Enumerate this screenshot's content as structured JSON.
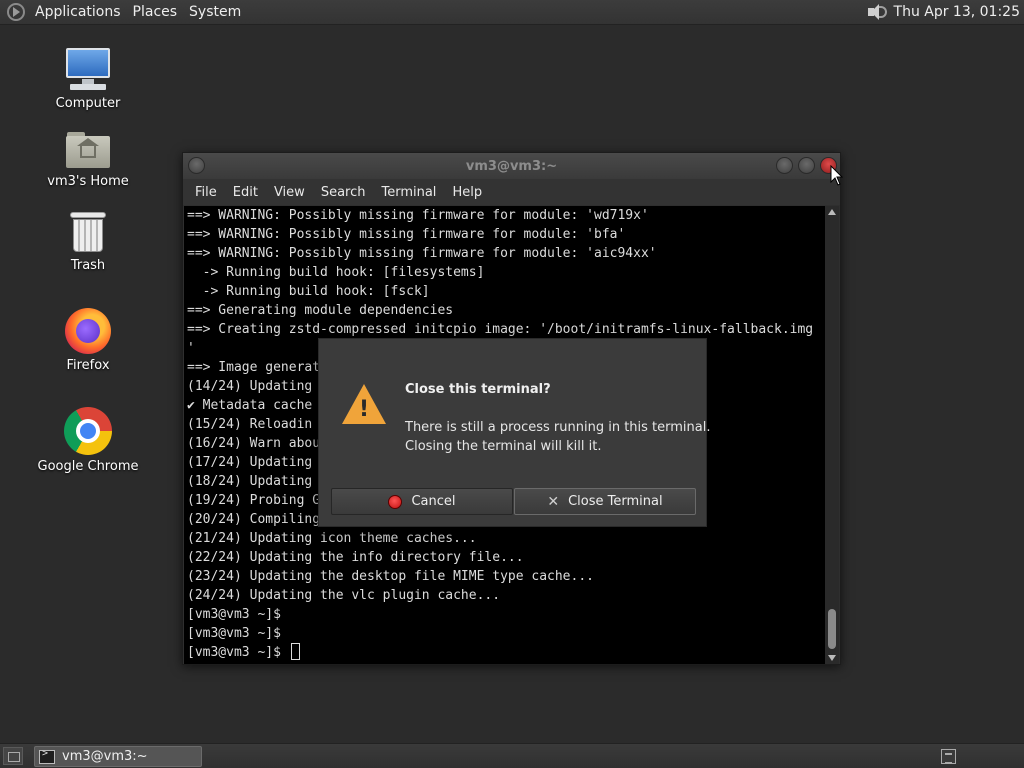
{
  "top_panel": {
    "menus": [
      "Applications",
      "Places",
      "System"
    ],
    "clock": "Thu Apr 13, 01:25",
    "volume_icon": "volume-icon"
  },
  "desktop_icons": [
    {
      "label": "Computer",
      "icon": "computer-icon"
    },
    {
      "label": "vm3's Home",
      "icon": "home-folder-icon"
    },
    {
      "label": "Trash",
      "icon": "trash-icon"
    },
    {
      "label": "Firefox",
      "icon": "firefox-icon"
    },
    {
      "label": "Google Chrome",
      "icon": "chrome-icon"
    }
  ],
  "terminal": {
    "title": "vm3@vm3:~",
    "menu": [
      "File",
      "Edit",
      "View",
      "Search",
      "Terminal",
      "Help"
    ],
    "lines": [
      "==> WARNING: Possibly missing firmware for module: 'wd719x'",
      "==> WARNING: Possibly missing firmware for module: 'bfa'",
      "==> WARNING: Possibly missing firmware for module: 'aic94xx'",
      "  -> Running build hook: [filesystems]",
      "  -> Running build hook: [fsck]",
      "==> Generating module dependencies",
      "==> Creating zstd-compressed initcpio image: '/boot/initramfs-linux-fallback.img",
      "'",
      "==> Image generat",
      "(14/24) Updating",
      "✔ Metadata cache",
      "(15/24) Reloadin",
      "(16/24) Warn abou",
      "(17/24) Updating",
      "(18/24) Updating",
      "(19/24) Probing G",
      "(20/24) Compiling",
      "(21/24) Updating icon theme caches...",
      "(22/24) Updating the info directory file...",
      "(23/24) Updating the desktop file MIME type cache...",
      "(24/24) Updating the vlc plugin cache...",
      "[vm3@vm3 ~]$",
      "[vm3@vm3 ~]$",
      "[vm3@vm3 ~]$ "
    ]
  },
  "dialog": {
    "title": "Close this terminal?",
    "message_line1": "There is still a process running in this terminal.",
    "message_line2": "Closing the terminal will kill it.",
    "cancel_label": "Cancel",
    "close_label": "Close Terminal",
    "icon": "warning-icon"
  },
  "taskbar": {
    "task_label": "vm3@vm3:~"
  }
}
